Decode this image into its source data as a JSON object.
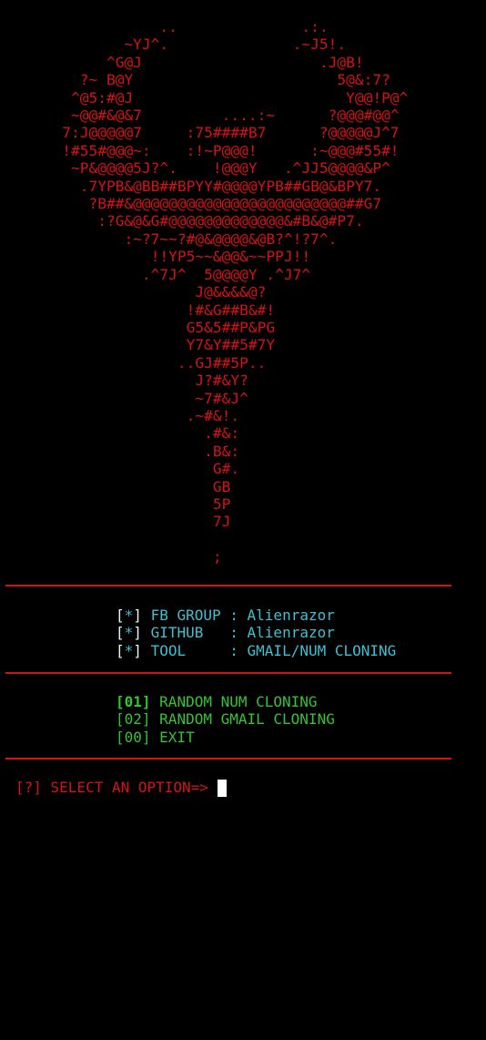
{
  "banner": {
    "art_lines": [
      "                  ..              .:.",
      "              ~YJ^.              .~J5!.",
      "            ^G@J                    .J@B!",
      "         ?~ B@Y                       5@&:7?",
      "        ^@5:#@J                        Y@@!P@^",
      "        ~@@#&@&7         ....:~      ?@@@#@@^",
      "       7:J@@@@@7     :75####B7      ?@@@@@J^7",
      "       !#55#@@@~:    :!~P@@@!      :~@@@#55#!",
      "        ~P&@@@@5J?^.    !@@@Y   .^JJ5@@@@&P^",
      "         .7YPB&@BB##BPYY#@@@@YPB##GB@&BPY7.",
      "          ?B##&@@@@@@@@@@@@@@@@@@@@@@@@##G7",
      "           :?G&@&G#@@@@@@@@@@@@@&#B&@#P7.",
      "              :~?7~~?#@&@@@@&@B?^!?7^.",
      "                 !!YP5~~&@@&~~PPJ!!",
      "                .^7J^  5@@@@Y .^J7^",
      "                      J@&&&&@?",
      "                     !#&G##B&#!",
      "                     G5&5##P&PG",
      "                     Y7&Y##5#7Y",
      "                    ..GJ##5P..",
      "                      J?#&Y?",
      "                      ~7#&J^",
      "                     .~#&!.",
      "                       .#&:",
      "                       .B&:",
      "                        G#.",
      "                        GB",
      "                        5P",
      "                        7J",
      "",
      "                        ;"
    ]
  },
  "info": {
    "items": [
      {
        "open": "[",
        "star": "*",
        "close": "]",
        "label": "FB GROUP",
        "sep": " : ",
        "value": "Alienrazor"
      },
      {
        "open": "[",
        "star": "*",
        "close": "]",
        "label": "GITHUB  ",
        "sep": " : ",
        "value": "Alienrazor"
      },
      {
        "open": "[",
        "star": "*",
        "close": "]",
        "label": "TOOL    ",
        "sep": " : ",
        "value": "GMAIL/NUM CLONING"
      }
    ]
  },
  "menu": {
    "options": [
      {
        "code": "[01]",
        "label": "RANDOM NUM CLONING"
      },
      {
        "code": "[02]",
        "label": "RANDOM GMAIL CLONING"
      },
      {
        "code": "[00]",
        "label": "EXIT"
      }
    ]
  },
  "prompt": {
    "text": "[?] SELECT AN OPTION=>"
  },
  "colors": {
    "background": "#000000",
    "art_red": "#d21414",
    "info_cyan": "#3fbfd0",
    "menu_green": "#35c235",
    "cursor_white": "#ffffff"
  }
}
